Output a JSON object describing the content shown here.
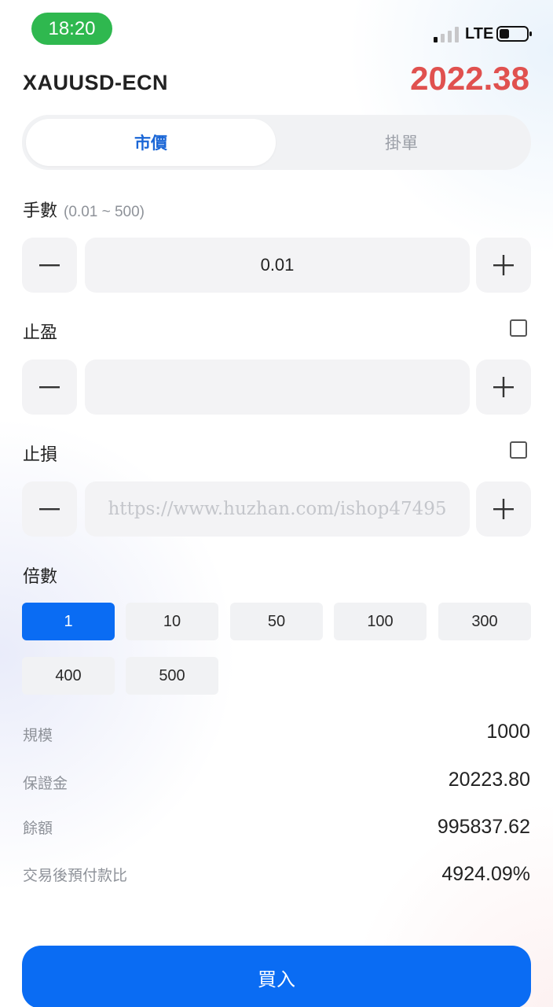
{
  "status_bar": {
    "time": "18:20",
    "network": "LTE",
    "signal_bars_active": 1,
    "battery_level": 0.35
  },
  "header": {
    "symbol": "XAUUSD-ECN",
    "price": "2022.38",
    "price_color": "#e0514f"
  },
  "tabs": [
    {
      "label": "市價",
      "active": true
    },
    {
      "label": "掛單",
      "active": false
    }
  ],
  "lots": {
    "label": "手數",
    "range": "(0.01 ~ 500)",
    "value": "0.01"
  },
  "take_profit": {
    "label": "止盈",
    "checked": false,
    "value": ""
  },
  "stop_loss": {
    "label": "止損",
    "checked": false,
    "value": "https://www.huzhan.com/ishop47495"
  },
  "leverage": {
    "label": "倍數",
    "options": [
      "1",
      "10",
      "50",
      "100",
      "300",
      "400",
      "500"
    ],
    "selected": "1"
  },
  "info": {
    "size_label": "規模",
    "size_value": "1000",
    "margin_label": "保證金",
    "margin_value": "20223.80",
    "balance_label": "餘額",
    "balance_value": "995837.62",
    "ratio_label": "交易後預付款比",
    "ratio_value": "4924.09%"
  },
  "buy_button": {
    "label": "買入"
  },
  "colors": {
    "accent": "#0a6cf3",
    "tab_active_text": "#1a66d6",
    "status_pill": "#2fb84f"
  },
  "icons": {
    "minus": "minus-icon",
    "plus": "plus-icon",
    "signal": "signal-icon",
    "battery": "battery-icon"
  }
}
